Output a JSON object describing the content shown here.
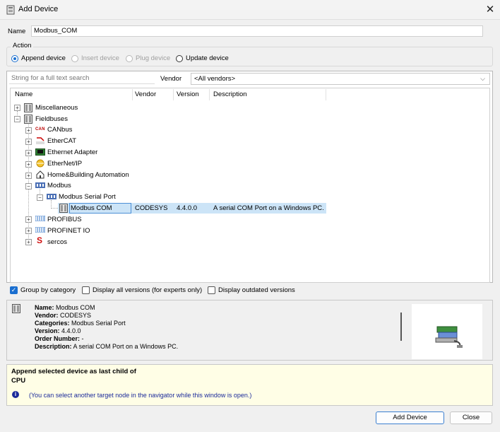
{
  "window": {
    "title": "Add Device",
    "close_icon": "close-icon"
  },
  "name_field": {
    "label": "Name",
    "value": "Modbus_COM"
  },
  "action": {
    "label": "Action",
    "options": [
      {
        "label": "Append device",
        "checked": true,
        "enabled": true
      },
      {
        "label": "Insert device",
        "checked": false,
        "enabled": false
      },
      {
        "label": "Plug device",
        "checked": false,
        "enabled": false
      },
      {
        "label": "Update device",
        "checked": false,
        "enabled": true
      }
    ]
  },
  "search": {
    "placeholder": "String for a full text search"
  },
  "vendor": {
    "label": "Vendor",
    "value": "<All vendors>"
  },
  "columns": [
    "Name",
    "Vendor",
    "Version",
    "Description"
  ],
  "tree": [
    {
      "label": "Miscellaneous",
      "level": 0,
      "expander": "+"
    },
    {
      "label": "Fieldbuses",
      "level": 0,
      "expander": "-"
    },
    {
      "label": "CANbus",
      "level": 1,
      "expander": "+",
      "icon_text": "CAN"
    },
    {
      "label": "EtherCAT",
      "level": 1,
      "expander": "+"
    },
    {
      "label": "Ethernet Adapter",
      "level": 1,
      "expander": "+"
    },
    {
      "label": "EtherNet/IP",
      "level": 1,
      "expander": "+"
    },
    {
      "label": "Home&Building Automation",
      "level": 1,
      "expander": "+"
    },
    {
      "label": "Modbus",
      "level": 1,
      "expander": "-"
    },
    {
      "label": "Modbus Serial Port",
      "level": 2,
      "expander": "-"
    },
    {
      "label": "Modbus COM",
      "level": 3,
      "vendor": "CODESYS",
      "version": "4.4.0.0",
      "description": "A serial COM Port on a Windows PC.",
      "selected": true
    },
    {
      "label": "PROFIBUS",
      "level": 1,
      "expander": "+"
    },
    {
      "label": "PROFINET IO",
      "level": 1,
      "expander": "+"
    },
    {
      "label": "sercos",
      "level": 1,
      "expander": "+",
      "icon_text": "S"
    }
  ],
  "options": {
    "group_by_category": {
      "label": "Group by category",
      "checked": true
    },
    "display_all_versions": {
      "label": "Display all versions (for experts only)",
      "checked": false
    },
    "display_outdated": {
      "label": "Display outdated versions",
      "checked": false
    }
  },
  "info": {
    "name_label": "Name:",
    "name": "Modbus COM",
    "vendor_label": "Vendor:",
    "vendor": "CODESYS",
    "categories_label": "Categories:",
    "categories": "Modbus Serial Port",
    "version_label": "Version:",
    "version": "4.4.0.0",
    "order_label": "Order Number:",
    "order": "-",
    "description_label": "Description:",
    "description": "A serial COM Port on a Windows PC."
  },
  "hint": {
    "line1": "Append selected device as last child of",
    "line2": "CPU",
    "note": "(You can select another target node in the navigator while this window is open.)"
  },
  "buttons": {
    "add_device": "Add Device",
    "close": "Close"
  },
  "colors": {
    "selection": "#cce4f7",
    "accent": "#1a6fd0",
    "hint_bg": "#fffee6",
    "hint_text": "#1b2a9a"
  }
}
